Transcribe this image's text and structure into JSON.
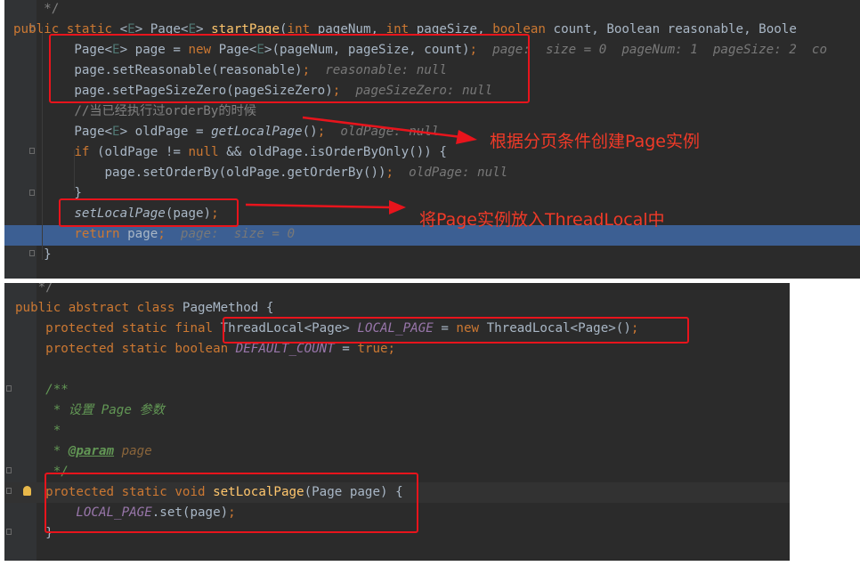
{
  "screenshot_top": {
    "code_lines": [
      [
        {
          "c": "cm",
          "t": "    */"
        }
      ],
      [
        {
          "c": "kw",
          "t": "public static "
        },
        {
          "c": "",
          "t": "<"
        },
        {
          "c": "tp",
          "t": "E"
        },
        {
          "c": "",
          "t": "> Page<"
        },
        {
          "c": "tp",
          "t": "E"
        },
        {
          "c": "",
          "t": "> "
        },
        {
          "c": "fn",
          "t": "startPage"
        },
        {
          "c": "",
          "t": "("
        },
        {
          "c": "kw",
          "t": "int "
        },
        {
          "c": "",
          "t": "pageNum, "
        },
        {
          "c": "kw",
          "t": "int "
        },
        {
          "c": "",
          "t": "pageSize, "
        },
        {
          "c": "kw",
          "t": "boolean "
        },
        {
          "c": "",
          "t": "count, Boolean reasonable, Boole"
        }
      ],
      [
        {
          "c": "",
          "t": "        Page<"
        },
        {
          "c": "tp",
          "t": "E"
        },
        {
          "c": "",
          "t": "> page = "
        },
        {
          "c": "kw",
          "t": "new "
        },
        {
          "c": "",
          "t": "Page<"
        },
        {
          "c": "tp",
          "t": "E"
        },
        {
          "c": "",
          "t": ">(pageNum, pageSize, count)"
        },
        {
          "c": "kw",
          "t": ";"
        },
        {
          "c": "hint",
          "t": "  page:  size = 0  pageNum: 1  pageSize: 2  co"
        }
      ],
      [
        {
          "c": "",
          "t": "        page.setReasonable(reasonable)"
        },
        {
          "c": "kw",
          "t": ";"
        },
        {
          "c": "hint",
          "t": "  reasonable: null"
        }
      ],
      [
        {
          "c": "",
          "t": "        page.setPageSizeZero(pageSizeZero)"
        },
        {
          "c": "kw",
          "t": ";"
        },
        {
          "c": "hint",
          "t": "  pageSizeZero: null"
        }
      ],
      [
        {
          "c": "cm",
          "t": "        //当已经执行过orderBy的时候"
        }
      ],
      [
        {
          "c": "",
          "t": "        Page<"
        },
        {
          "c": "tp",
          "t": "E"
        },
        {
          "c": "",
          "t": "> oldPage = "
        },
        {
          "c": "it",
          "t": "getLocalPage"
        },
        {
          "c": "",
          "t": "()"
        },
        {
          "c": "kw",
          "t": ";"
        },
        {
          "c": "hint",
          "t": "  oldPage: null"
        }
      ],
      [
        {
          "c": "kw",
          "t": "        if "
        },
        {
          "c": "",
          "t": "(oldPage != "
        },
        {
          "c": "kw",
          "t": "null "
        },
        {
          "c": "",
          "t": "&& oldPage.isOrderByOnly()) {"
        }
      ],
      [
        {
          "c": "",
          "t": "            page.setOrderBy(oldPage.getOrderBy())"
        },
        {
          "c": "kw",
          "t": ";"
        },
        {
          "c": "hint",
          "t": "  oldPage: null"
        }
      ],
      [
        {
          "c": "",
          "t": "        }"
        }
      ],
      [
        {
          "c": "it",
          "t": "        setLocalPage"
        },
        {
          "c": "",
          "t": "(page)"
        },
        {
          "c": "kw",
          "t": ";"
        }
      ],
      [
        {
          "c": "kw",
          "t": "        return "
        },
        {
          "c": "",
          "t": "page"
        },
        {
          "c": "kw",
          "t": ";"
        },
        {
          "c": "hint",
          "t": "  page:  size = 0"
        }
      ],
      [
        {
          "c": "",
          "t": "    }"
        }
      ]
    ],
    "annotation_1": "根据分页条件创建Page实例",
    "annotation_2": "将Page实例放入ThreadLocal中"
  },
  "screenshot_bottom": {
    "code_lines": [
      [
        {
          "c": "cm",
          "t": "   */"
        }
      ],
      [
        {
          "c": "kw",
          "t": "public abstract class "
        },
        {
          "c": "",
          "t": "PageMethod {"
        }
      ],
      [
        {
          "c": "kw",
          "t": "    protected static final "
        },
        {
          "c": "",
          "t": "ThreadLocal<Page> "
        },
        {
          "c": "st",
          "t": "LOCAL_PAGE"
        },
        {
          "c": "",
          "t": " = "
        },
        {
          "c": "kw",
          "t": "new "
        },
        {
          "c": "",
          "t": "ThreadLocal<Page>()"
        },
        {
          "c": "kw",
          "t": ";"
        }
      ],
      [
        {
          "c": "kw",
          "t": "    protected static boolean "
        },
        {
          "c": "st",
          "t": "DEFAULT_COUNT"
        },
        {
          "c": "",
          "t": " = "
        },
        {
          "c": "kw",
          "t": "true;"
        }
      ],
      [
        {
          "c": "",
          "t": ""
        }
      ],
      [
        {
          "c": "dc",
          "t": "    /**"
        }
      ],
      [
        {
          "c": "dc",
          "t": "     * 设置 Page 参数"
        }
      ],
      [
        {
          "c": "dc",
          "t": "     *"
        }
      ],
      [
        {
          "c": "dc",
          "t": "     * "
        },
        {
          "c": "dt",
          "t": "@param"
        },
        {
          "c": "dp",
          "t": " page"
        }
      ],
      [
        {
          "c": "dc",
          "t": "     */"
        }
      ],
      [
        {
          "c": "kw",
          "t": "    protected static void "
        },
        {
          "c": "fn",
          "t": "setLocalPage"
        },
        {
          "c": "",
          "t": "(Page page) {"
        }
      ],
      [
        {
          "c": "st",
          "t": "        LOCAL_PAGE"
        },
        {
          "c": "",
          "t": ".set(page)"
        },
        {
          "c": "kw",
          "t": ";"
        }
      ],
      [
        {
          "c": "",
          "t": "    }"
        }
      ]
    ]
  },
  "colors": {
    "editor_bg": "#2b2b2b",
    "keyword": "#cc7832",
    "method_decl": "#ffc66d",
    "static_field": "#9876aa",
    "comment": "#808080",
    "doc_comment": "#629755",
    "highlight_box": "#e8141c",
    "annotation_text": "#f03a28",
    "selected_line": "#3c5f93"
  }
}
